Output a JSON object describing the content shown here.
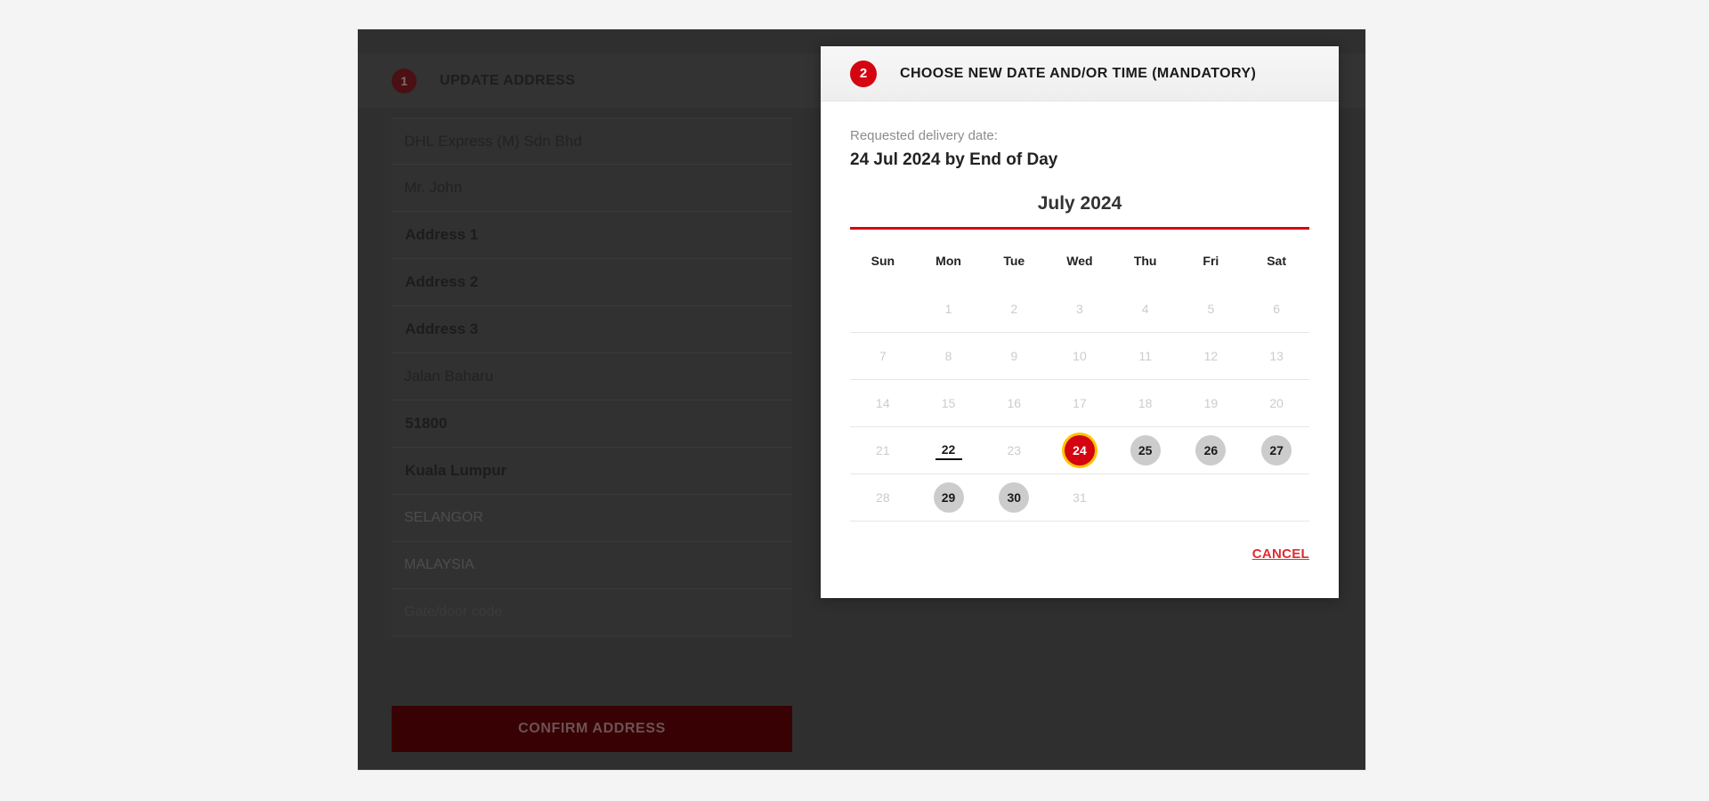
{
  "theme": {
    "page_background": "#f4f4f4",
    "dhl_red": "#d40511",
    "focus_ring": "#ffc400",
    "available_day": "#cccccc",
    "disabled_day": "#cccccc"
  },
  "left_panel": {
    "step_number": "1",
    "title": "UPDATE ADDRESS",
    "fields": [
      {
        "value": "DHL Express (M) Sdn Bhd",
        "style": "normal"
      },
      {
        "value": "Mr. John",
        "style": "normal"
      },
      {
        "value": "Address 1",
        "style": "bold"
      },
      {
        "value": "Address 2",
        "style": "bold"
      },
      {
        "value": "Address 3",
        "style": "bold"
      },
      {
        "value": "Jalan Baharu",
        "style": "normal"
      },
      {
        "value": "51800",
        "style": "bold"
      },
      {
        "value": "Kuala Lumpur",
        "style": "bold"
      },
      {
        "value": "SELANGOR",
        "style": "muted"
      },
      {
        "value": "MALAYSIA",
        "style": "muted"
      },
      {
        "value": "Gate/door code",
        "style": "placeholder"
      }
    ],
    "confirm_button": "CONFIRM ADDRESS"
  },
  "modal": {
    "step_number": "2",
    "title": "CHOOSE NEW DATE AND/OR TIME (MANDATORY)",
    "requested_label": "Requested delivery date:",
    "requested_value": "24 Jul 2024 by End of Day",
    "calendar": {
      "month_title": "July 2024",
      "weekday_headers": [
        "Sun",
        "Mon",
        "Tue",
        "Wed",
        "Thu",
        "Fri",
        "Sat"
      ],
      "weeks": [
        [
          {
            "label": "",
            "state": "empty"
          },
          {
            "label": "1",
            "state": "disabled"
          },
          {
            "label": "2",
            "state": "disabled"
          },
          {
            "label": "3",
            "state": "disabled"
          },
          {
            "label": "4",
            "state": "disabled"
          },
          {
            "label": "5",
            "state": "disabled"
          },
          {
            "label": "6",
            "state": "disabled"
          }
        ],
        [
          {
            "label": "7",
            "state": "disabled"
          },
          {
            "label": "8",
            "state": "disabled"
          },
          {
            "label": "9",
            "state": "disabled"
          },
          {
            "label": "10",
            "state": "disabled"
          },
          {
            "label": "11",
            "state": "disabled"
          },
          {
            "label": "12",
            "state": "disabled"
          },
          {
            "label": "13",
            "state": "disabled"
          }
        ],
        [
          {
            "label": "14",
            "state": "disabled"
          },
          {
            "label": "15",
            "state": "disabled"
          },
          {
            "label": "16",
            "state": "disabled"
          },
          {
            "label": "17",
            "state": "disabled"
          },
          {
            "label": "18",
            "state": "disabled"
          },
          {
            "label": "19",
            "state": "disabled"
          },
          {
            "label": "20",
            "state": "disabled"
          }
        ],
        [
          {
            "label": "21",
            "state": "disabled"
          },
          {
            "label": "22",
            "state": "today"
          },
          {
            "label": "23",
            "state": "disabled"
          },
          {
            "label": "24",
            "state": "selected"
          },
          {
            "label": "25",
            "state": "available"
          },
          {
            "label": "26",
            "state": "available"
          },
          {
            "label": "27",
            "state": "available"
          }
        ],
        [
          {
            "label": "28",
            "state": "disabled"
          },
          {
            "label": "29",
            "state": "available"
          },
          {
            "label": "30",
            "state": "available"
          },
          {
            "label": "31",
            "state": "disabled"
          },
          {
            "label": "",
            "state": "empty"
          },
          {
            "label": "",
            "state": "empty"
          },
          {
            "label": "",
            "state": "empty"
          }
        ]
      ]
    },
    "cancel_label": "CANCEL"
  }
}
